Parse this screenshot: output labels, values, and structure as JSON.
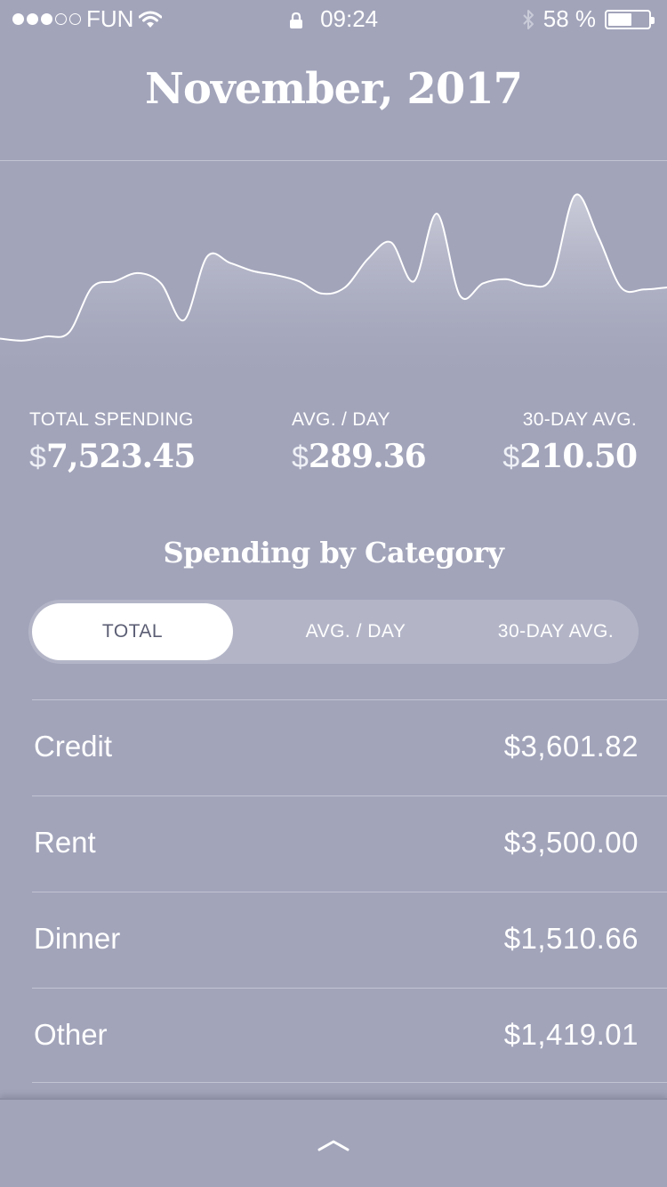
{
  "status_bar": {
    "carrier": "FUN",
    "time": "09:24",
    "battery_text": "58 %",
    "battery_level": 0.58,
    "signal_bars_filled": 3,
    "signal_bars_total": 5
  },
  "header": {
    "title": "November, 2017"
  },
  "spending_chart": {
    "type": "area",
    "line_color": "#ffffff",
    "values": [
      0.05,
      0.04,
      0.06,
      0.08,
      0.3,
      0.33,
      0.37,
      0.32,
      0.14,
      0.45,
      0.42,
      0.38,
      0.36,
      0.33,
      0.27,
      0.3,
      0.44,
      0.52,
      0.33,
      0.66,
      0.26,
      0.32,
      0.34,
      0.31,
      0.35,
      0.75,
      0.55,
      0.3,
      0.29,
      0.3
    ]
  },
  "stats": [
    {
      "label": "TOTAL SPENDING",
      "currency": "$",
      "value": "7,523.45"
    },
    {
      "label": "AVG. / DAY",
      "currency": "$",
      "value": "289.36"
    },
    {
      "label": "30-DAY AVG.",
      "currency": "$",
      "value": "210.50"
    }
  ],
  "category_section": {
    "title": "Spending by Category",
    "tabs": [
      {
        "label": "TOTAL",
        "active": true
      },
      {
        "label": "AVG. / DAY",
        "active": false
      },
      {
        "label": "30-DAY AVG.",
        "active": false
      }
    ],
    "items": [
      {
        "name": "Credit",
        "amount": "$3,601.82"
      },
      {
        "name": "Rent",
        "amount": "$3,500.00"
      },
      {
        "name": "Dinner",
        "amount": "$1,510.66"
      },
      {
        "name": "Other",
        "amount": "$1,419.01"
      }
    ]
  },
  "icons": {
    "signal": "signal-dots-icon",
    "wifi": "wifi-icon",
    "lock": "lock-icon",
    "bluetooth": "bluetooth-icon",
    "battery": "battery-icon",
    "expand": "chevron-up-icon"
  }
}
